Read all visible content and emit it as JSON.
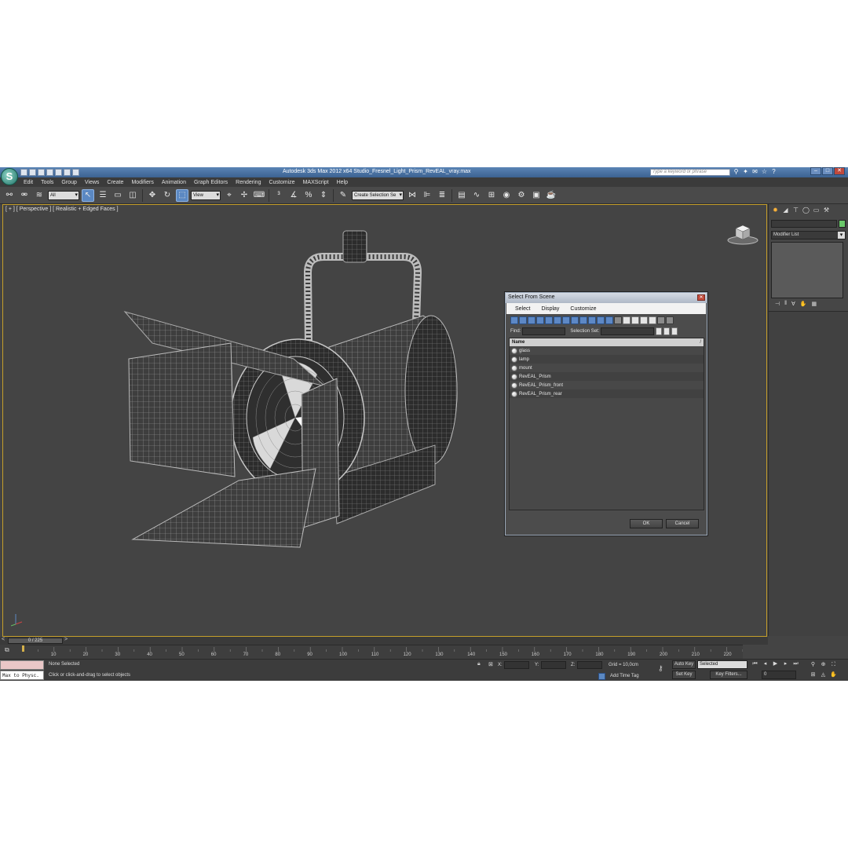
{
  "window": {
    "title": "Autodesk 3ds Max  2012 x64     Studio_Fresnel_Light_Prism_RevEAL_vray.max",
    "search_placeholder": "Type a keyword or phrase",
    "logo_icon": "3ds-max-logo-icon"
  },
  "menu": [
    "Edit",
    "Tools",
    "Group",
    "Views",
    "Create",
    "Modifiers",
    "Animation",
    "Graph Editors",
    "Rendering",
    "Customize",
    "MAXScript",
    "Help"
  ],
  "toolbar": {
    "selection_filter": "All",
    "reference_coord": "View",
    "named_selection": "Create Selection Se"
  },
  "viewport": {
    "label": "[ + ] [ Perspective ] [ Realistic + Edged Faces ]"
  },
  "dialog": {
    "title": "Select From Scene",
    "tabs": [
      "Select",
      "Display",
      "Customize"
    ],
    "find_label": "Find:",
    "selection_set_label": "Selection Set:",
    "column_header": "Name",
    "items": [
      "glass",
      "lamp",
      "mount",
      "RevEAL_Prism",
      "RevEAL_Prism_front",
      "RevEAL_Prism_rear"
    ],
    "ok_label": "OK",
    "cancel_label": "Cancel"
  },
  "command_panel": {
    "modifier_list": "Modifier List",
    "swatch_color": "#6ac86a"
  },
  "timeline": {
    "frame_counter": "0 / 225",
    "ticks": [
      "10",
      "20",
      "30",
      "40",
      "50",
      "60",
      "70",
      "80",
      "90",
      "100",
      "110",
      "120",
      "130",
      "140",
      "150",
      "160",
      "170",
      "180",
      "190",
      "200",
      "210",
      "220"
    ]
  },
  "status": {
    "maxscript_listener": "Max to Physc.",
    "selection": "None Selected",
    "prompt": "Click or click-and-drag to select objects",
    "x_label": "X:",
    "y_label": "Y:",
    "z_label": "Z:",
    "grid": "Grid = 10,0cm",
    "add_time_tag": "Add Time Tag",
    "auto_key": "Auto Key",
    "set_key": "Set Key",
    "key_mode": "Selected",
    "key_filters": "Key Filters...",
    "current_frame": "0"
  },
  "colors": {
    "accent": "#5b88c2",
    "viewport_border": "#c59f2a",
    "viewport_bg": "#444444"
  }
}
